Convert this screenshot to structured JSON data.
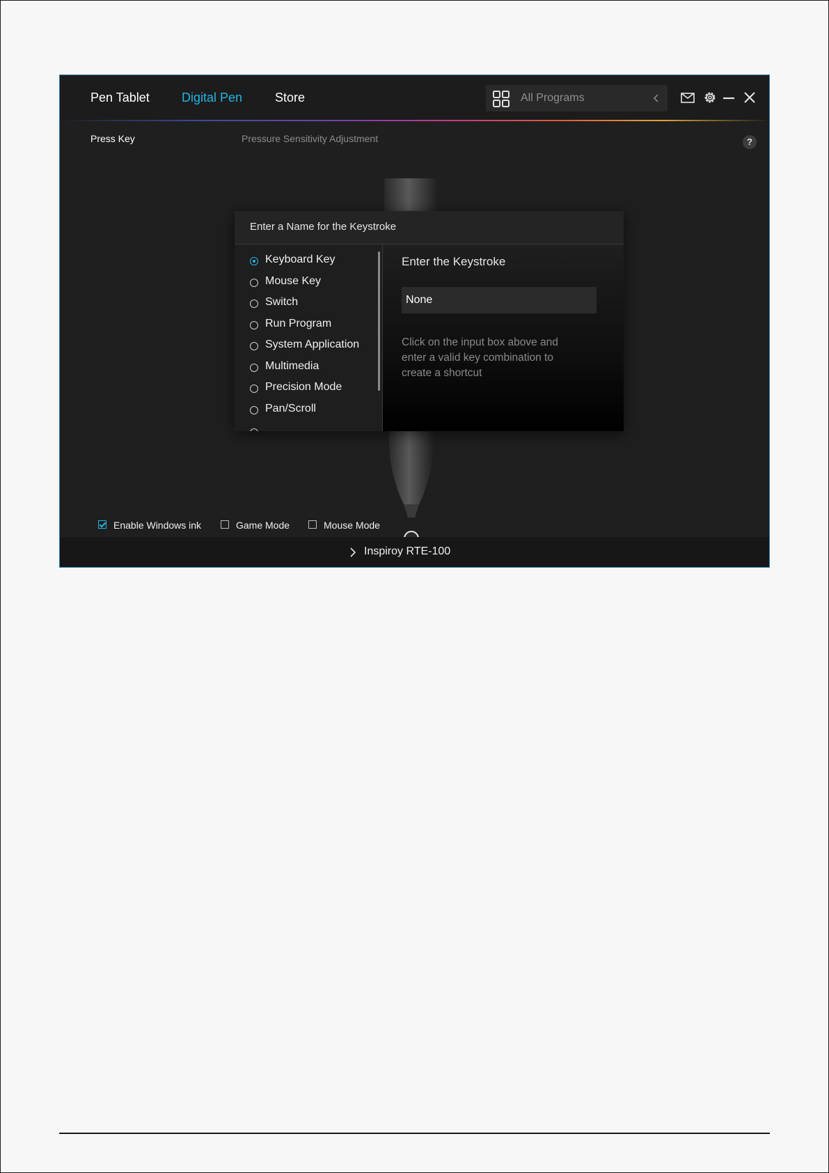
{
  "header": {
    "tabs": [
      {
        "label": "Pen Tablet",
        "active": false
      },
      {
        "label": "Digital Pen",
        "active": true
      },
      {
        "label": "Store",
        "active": false
      }
    ],
    "program_select": {
      "label": "All Programs",
      "icon": "apps-grid-icon"
    },
    "window_controls": [
      "mail-icon",
      "gear-icon",
      "minimize-icon",
      "close-icon"
    ]
  },
  "subnav": {
    "press_key_label": "Press Key",
    "pressure_label": "Pressure Sensitivity Adjustment",
    "help_label": "?"
  },
  "dialog": {
    "title": "Enter a Name for the Keystroke",
    "options": [
      {
        "label": "Keyboard Key",
        "checked": true
      },
      {
        "label": "Mouse Key",
        "checked": false
      },
      {
        "label": "Switch",
        "checked": false
      },
      {
        "label": "Run Program",
        "checked": false
      },
      {
        "label": "System Application",
        "checked": false
      },
      {
        "label": "Multimedia",
        "checked": false
      },
      {
        "label": "Precision Mode",
        "checked": false
      },
      {
        "label": "Pan/Scroll",
        "checked": false
      }
    ],
    "keystroke_title": "Enter the Keystroke",
    "keystroke_value": "None",
    "keystroke_help": "Click on the input box above and enter a valid key combination to create a shortcut"
  },
  "options": {
    "enable_windows_ink": {
      "label": "Enable Windows ink",
      "checked": true
    },
    "game_mode": {
      "label": "Game Mode",
      "checked": false
    },
    "mouse_mode": {
      "label": "Mouse Mode",
      "checked": false
    }
  },
  "footer": {
    "device_label": "Inspiroy RTE-100"
  },
  "colors": {
    "accent": "#22b5e6",
    "background": "#1f1f1f"
  }
}
